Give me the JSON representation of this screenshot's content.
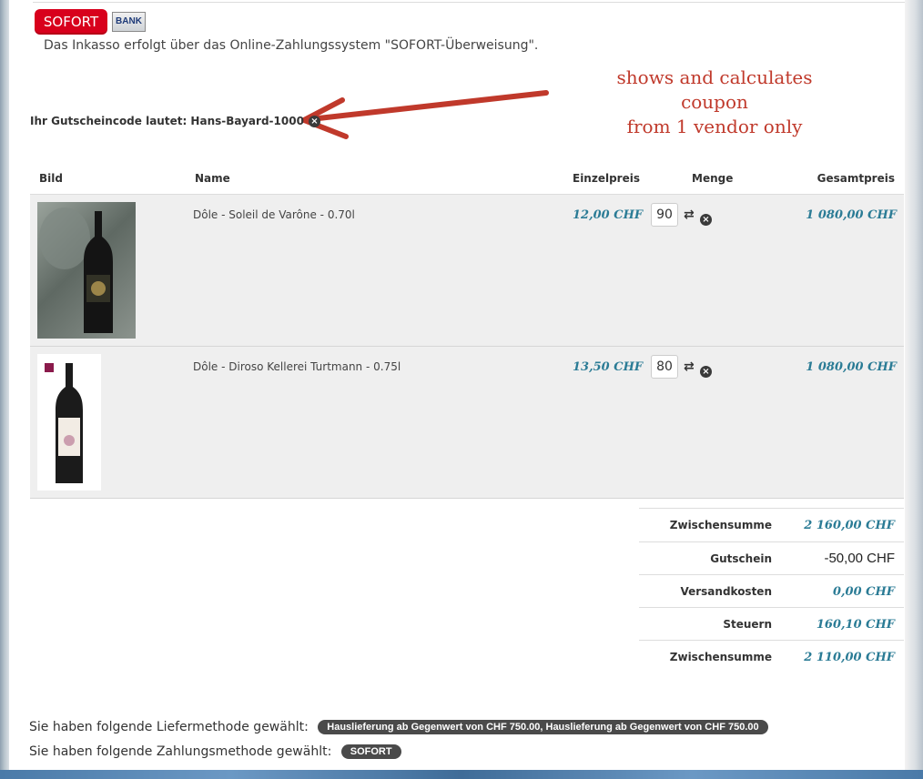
{
  "payment": {
    "sofort_label": "SOFORT",
    "bank_label": "BANK",
    "inkasso_text": "Das Inkasso erfolgt über das Online-Zahlungssystem \"SOFORT-Überweisung\"."
  },
  "annotation": {
    "line1": "shows and calculates coupon",
    "line2": "from 1 vendor only",
    "color": "#c0392b"
  },
  "coupon": {
    "text": "Ihr Gutscheincode lautet: Hans-Bayard-1000",
    "remove_icon": "×"
  },
  "table": {
    "headers": {
      "image": "Bild",
      "name": "Name",
      "unit_price": "Einzelpreis",
      "quantity": "Menge",
      "total": "Gesamtpreis"
    },
    "rows": [
      {
        "name": "Dôle - Soleil de Varône - 0.70l",
        "unit_price": "12,00 CHF",
        "quantity": "90",
        "total": "1 080,00 CHF"
      },
      {
        "name": "Dôle - Diroso Kellerei Turtmann - 0.75l",
        "unit_price": "13,50 CHF",
        "quantity": "80",
        "total": "1 080,00 CHF"
      }
    ]
  },
  "totals": {
    "subtotal_label": "Zwischensumme",
    "subtotal_value": "2 160,00 CHF",
    "coupon_label": "Gutschein",
    "coupon_value": "-50,00 CHF",
    "shipping_label": "Versandkosten",
    "shipping_value": "0,00 CHF",
    "tax_label": "Steuern",
    "tax_value": "160,10 CHF",
    "total_label": "Zwischensumme",
    "total_value": "2 110,00 CHF"
  },
  "footer": {
    "delivery_prefix": "Sie haben folgende Liefermethode gewählt:",
    "delivery_value": "Hauslieferung ab Gegenwert von CHF 750.00, Hauslieferung ab Gegenwert von CHF 750.00",
    "payment_prefix": "Sie haben folgende Zahlungsmethode gewählt:",
    "payment_value": "SOFORT"
  },
  "colors": {
    "price": "#2a7b95",
    "sofort_red": "#d8001c"
  }
}
